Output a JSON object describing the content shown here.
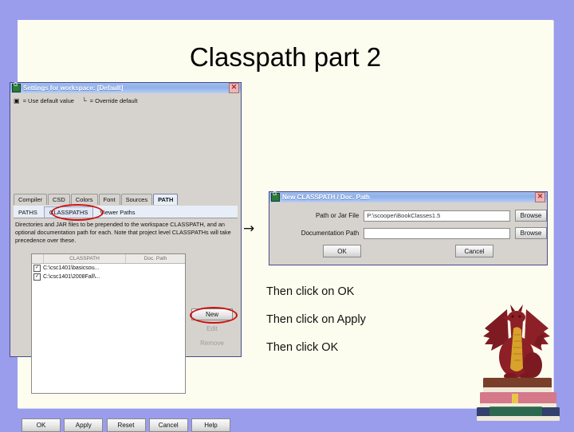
{
  "slide": {
    "title": "Classpath part 2",
    "arrow": "→"
  },
  "settings_dialog": {
    "title": "Settings for workspace: [Default]",
    "app_icon": "app-icon",
    "close_label": "✕",
    "legend": {
      "default_glyph": "▣",
      "default_text": "= Use default value",
      "override_glyph": "└",
      "override_text": "= Override default"
    },
    "tabs": [
      {
        "label": "Compiler",
        "selected": false
      },
      {
        "label": "CSD",
        "selected": false
      },
      {
        "label": "Colors",
        "selected": false
      },
      {
        "label": "Font",
        "selected": false
      },
      {
        "label": "Sources",
        "selected": false
      },
      {
        "label": "PATH",
        "selected": true
      }
    ],
    "subtabs": [
      {
        "label": "PATHS",
        "selected": false
      },
      {
        "label": "CLASSPATHS",
        "selected": true
      },
      {
        "label": "Viewer Paths",
        "selected": false
      }
    ],
    "description": "Directories and JAR files to be prepended to the workspace CLASSPATH, and an optional documentation path for each. Note that project level CLASSPATHs will take precedence over these.",
    "list": {
      "columns": [
        "CLASSPATH",
        "Doc. Path"
      ],
      "rows": [
        {
          "check": "☑",
          "classpath": "C:\\csc1401\\basicsou...",
          "doc_path": ""
        },
        {
          "check": "☑",
          "classpath": "C:\\csc1401\\2008Fall\\...",
          "doc_path": ""
        }
      ]
    },
    "side_buttons": [
      {
        "label": "New",
        "enabled": true,
        "highlighted": true
      },
      {
        "label": "Edit",
        "enabled": false,
        "highlighted": false
      },
      {
        "label": "Remove",
        "enabled": false,
        "highlighted": false
      }
    ],
    "bottom_buttons": [
      "OK",
      "Apply",
      "Reset",
      "Cancel",
      "Help"
    ]
  },
  "new_classpath_dialog": {
    "title": "New CLASSPATH / Doc. Path",
    "app_icon": "app-icon",
    "close_label": "✕",
    "path_label": "Path or Jar File",
    "path_value": "P:\\scooper\\BookClasses1.5",
    "doc_label": "Documentation Path",
    "doc_value": "",
    "browse_label_1": "Browse",
    "browse_label_2": "Browse",
    "ok_label": "OK",
    "cancel_label": "Cancel"
  },
  "instructions": [
    "Then click on OK",
    "Then click on Apply",
    "Then click OK"
  ],
  "colors": {
    "background": "#9a9cec",
    "panel": "#fdfdef",
    "titlebar": "#8fb0ea",
    "highlight_ring": "#cc1111",
    "dragon_body": "#8d1f26",
    "dragon_belly": "#d8a22b"
  }
}
